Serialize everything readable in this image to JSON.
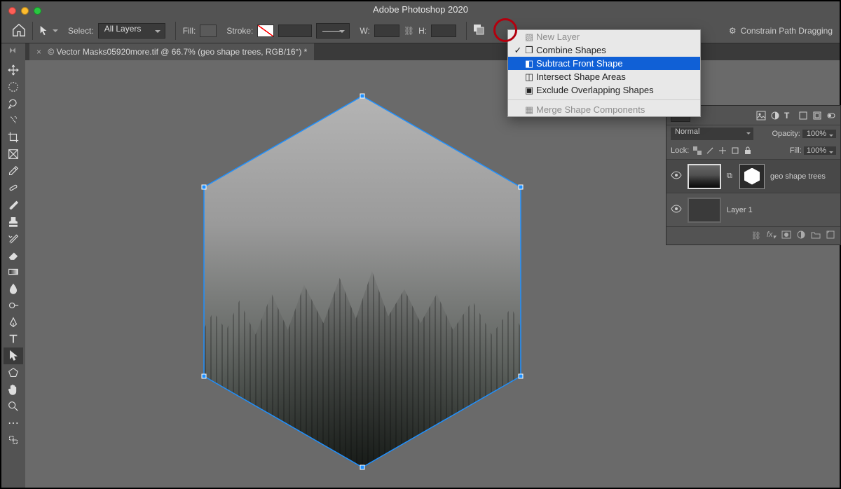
{
  "app_title": "Adobe Photoshop 2020",
  "mac_dots": {
    "close": "#ff5f57",
    "min": "#febc2e",
    "max": "#28c840"
  },
  "options_bar": {
    "select_label": "Select:",
    "select_value": "All Layers",
    "fill_label": "Fill:",
    "stroke_label": "Stroke:",
    "w_label": "W:",
    "h_label": "H:",
    "constrain": "Constrain Path Dragging"
  },
  "doc_tab": "© Vector Masks05920more.tif @ 66.7% (geo shape trees, RGB/16°) *",
  "path_menu": {
    "items": [
      {
        "label": "New Layer",
        "disabled": true,
        "checked": false
      },
      {
        "label": "Combine Shapes",
        "disabled": false,
        "checked": true
      },
      {
        "label": "Subtract Front Shape",
        "disabled": false,
        "checked": false,
        "selected": true
      },
      {
        "label": "Intersect Shape Areas",
        "disabled": false,
        "checked": false
      },
      {
        "label": "Exclude Overlapping Shapes",
        "disabled": false,
        "checked": false
      }
    ],
    "merge": "Merge Shape Components"
  },
  "layers_panel": {
    "blend_mode": "Normal",
    "opacity_label": "Opacity:",
    "opacity_value": "100%",
    "lock_label": "Lock:",
    "fill_label": "Fill:",
    "fill_value": "100%",
    "layers": [
      {
        "name": "geo shape trees"
      },
      {
        "name": "Layer 1"
      }
    ]
  }
}
